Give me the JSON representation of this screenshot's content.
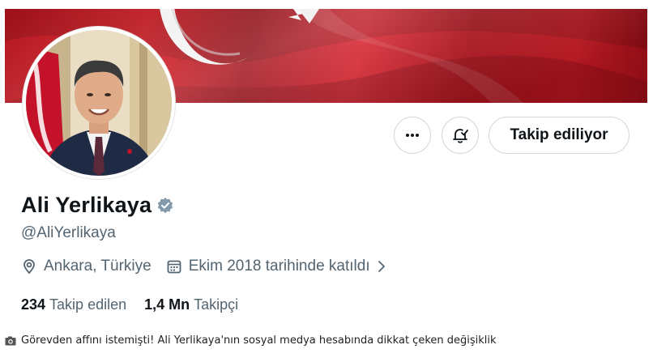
{
  "profile": {
    "display_name": "Ali Yerlikaya",
    "handle": "@AliYerlikaya",
    "location": "Ankara, Türkiye",
    "joined": "Ekim 2018 tarihinde katıldı",
    "following_count": "234",
    "following_label": "Takip edilen",
    "followers_count": "1,4 Mn",
    "followers_label": "Takipçi"
  },
  "actions": {
    "follow_label": "Takip ediliyor",
    "more_icon": "more-horizontal-icon",
    "notify_icon": "bell-check-icon"
  },
  "caption": {
    "text": "Görevden affını istemişti! Ali Yerlikaya'nın sosyal medya hesabında dikkat çeken değişiklik",
    "icon": "camera-icon"
  },
  "colors": {
    "banner_red": "#d71a22",
    "verified_gray": "#829aab",
    "secondary_text": "#536471",
    "border": "#cfd9de"
  }
}
